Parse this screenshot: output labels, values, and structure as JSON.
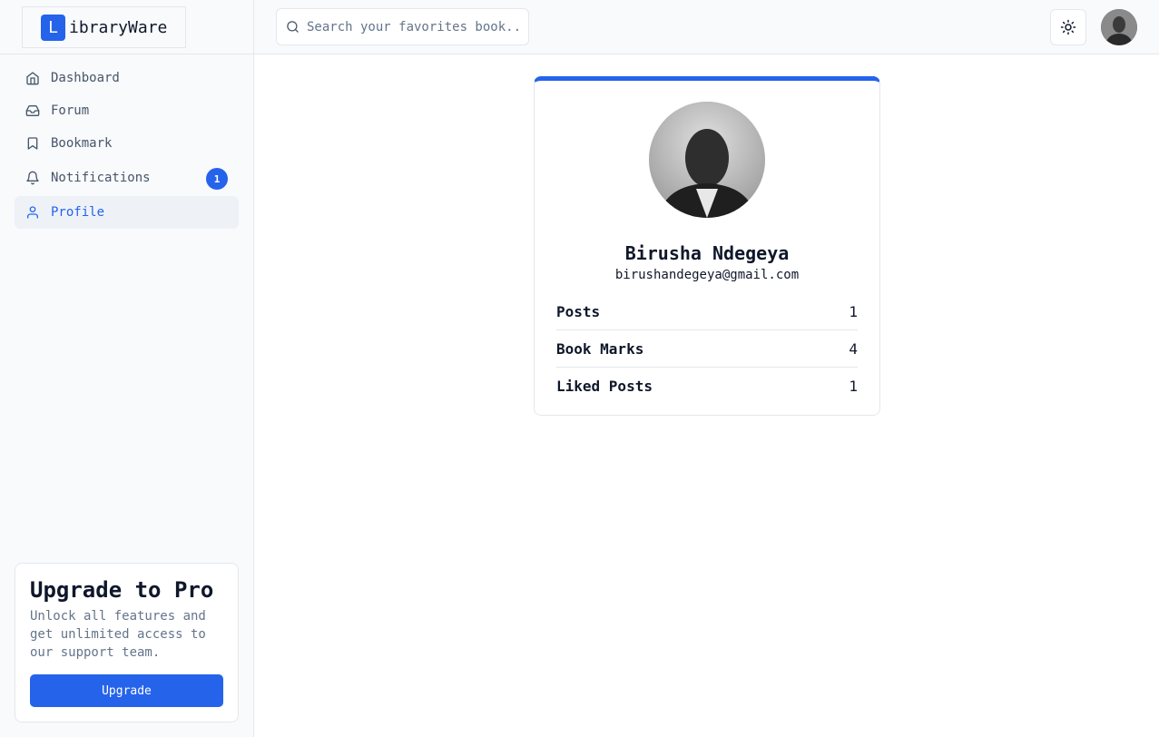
{
  "app": {
    "logo_letter": "L",
    "logo_text": "ibraryWare",
    "accent_color": "#2563eb"
  },
  "sidebar": {
    "items": [
      {
        "label": "Dashboard",
        "icon": "home-icon"
      },
      {
        "label": "Forum",
        "icon": "inbox-icon"
      },
      {
        "label": "Bookmark",
        "icon": "bookmark-icon"
      },
      {
        "label": "Notifications",
        "icon": "bell-icon",
        "badge": "1"
      },
      {
        "label": "Profile",
        "icon": "user-icon",
        "active": true
      }
    ],
    "upgrade": {
      "title": "Upgrade to Pro",
      "text": "Unlock all features and get unlimited access to our support team.",
      "button_label": "Upgrade"
    }
  },
  "header": {
    "search_placeholder": "Search your favorites book..",
    "theme_icon": "sun-icon"
  },
  "profile": {
    "name": "Birusha Ndegeya",
    "email": "birushandegeya@gmail.com",
    "stats": [
      {
        "label": "Posts",
        "value": "1"
      },
      {
        "label": "Book Marks",
        "value": "4"
      },
      {
        "label": "Liked Posts",
        "value": "1"
      }
    ]
  }
}
